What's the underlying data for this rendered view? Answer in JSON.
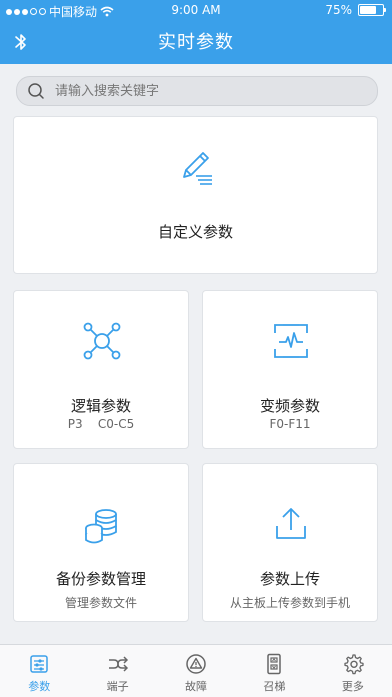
{
  "status_bar": {
    "carrier": "中国移动",
    "time": "9:00 AM",
    "battery": "75%"
  },
  "header": {
    "title": "实时参数"
  },
  "search": {
    "placeholder": "请输入搜索关键字"
  },
  "cards": {
    "custom": {
      "label": "自定义参数"
    },
    "logic": {
      "label": "逻辑参数",
      "sub": "P3    C0-C5"
    },
    "inverter": {
      "label": "变频参数",
      "sub": "F0-F11"
    },
    "backup": {
      "label": "备份参数管理",
      "sub": "管理参数文件"
    },
    "upload": {
      "label": "参数上传",
      "sub": "从主板上传参数到手机"
    }
  },
  "tabbar": {
    "items": [
      {
        "label": "参数",
        "icon": "params-icon",
        "active": true
      },
      {
        "label": "端子",
        "icon": "terminal-icon",
        "active": false
      },
      {
        "label": "故障",
        "icon": "fault-icon",
        "active": false
      },
      {
        "label": "召梯",
        "icon": "elevator-call-icon",
        "active": false
      },
      {
        "label": "更多",
        "icon": "gear-icon",
        "active": false
      }
    ]
  },
  "colors": {
    "accent": "#3aa0ea",
    "background": "#eef0f3"
  }
}
